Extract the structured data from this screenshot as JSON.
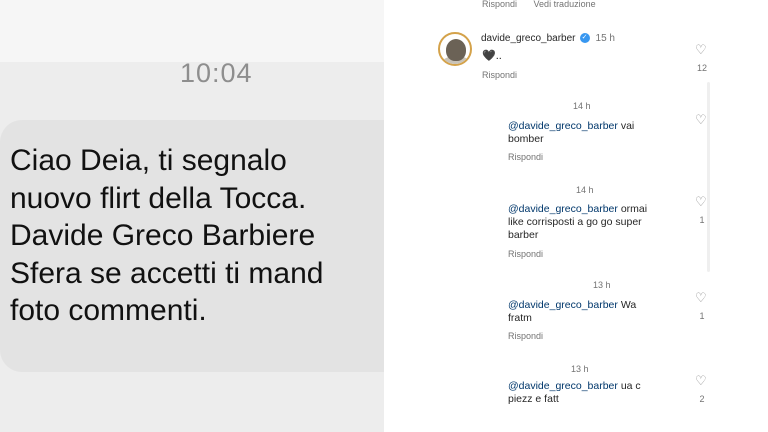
{
  "sms": {
    "time": "10:04",
    "message_lines": [
      "Ciao Deia, ti segnalo",
      "nuovo flirt della Tocca.",
      "Davide Greco Barbiere",
      "Sfera se accetti ti mand",
      "foto commenti."
    ]
  },
  "instagram": {
    "top_actions": {
      "reply": "Rispondi",
      "translate": "Vedi traduzione"
    },
    "post": {
      "username": "davide_greco_barber",
      "verified_icon": "verified-icon",
      "time_ago": "15 h",
      "text": "🖤..",
      "reply_label": "Rispondi",
      "likes": "12"
    },
    "comments": [
      {
        "time": "14 h",
        "mention": "@davide_greco_barber",
        "text_line1": " vai",
        "text_line2": "bomber",
        "reply_label": "Rispondi",
        "likes": ""
      },
      {
        "time": "14 h",
        "mention": "@davide_greco_barber",
        "text_line1": " ormai",
        "text_line2": "like corrisposti a go go  super",
        "text_line3": "barber",
        "reply_label": "Rispondi",
        "likes": "1"
      },
      {
        "time": "13 h",
        "mention": "@davide_greco_barber",
        "text_line1": " Wa",
        "text_line2": "fratm",
        "reply_label": "Rispondi",
        "likes": "1"
      },
      {
        "time": "13 h",
        "mention": "@davide_greco_barber",
        "text_line1": " ua c",
        "text_line2": "piezz e fatt",
        "likes": "2"
      }
    ]
  }
}
